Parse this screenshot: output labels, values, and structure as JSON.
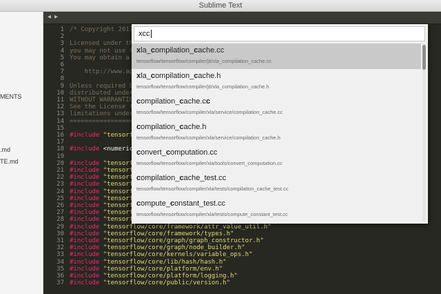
{
  "window": {
    "title": "Sublime Text"
  },
  "sidebar": {
    "items": [
      {
        "label": "MENTS"
      },
      {
        "label": ".md"
      },
      {
        "label": "TE.md"
      }
    ]
  },
  "tabbar": {
    "back": "◂",
    "forward": "▸"
  },
  "palette": {
    "query": "xcc",
    "results": [
      {
        "pre1": "",
        "m1": "x",
        "mid1": "la_",
        "m2": "c",
        "mid2": "ompilation_",
        "m3": "c",
        "post": "ache.cc",
        "path": "tensorflow/tensorflow/compiler/jit/xla_compilation_cache.cc"
      },
      {
        "pre1": "",
        "m1": "x",
        "mid1": "la_",
        "m2": "c",
        "mid2": "ompilation_",
        "m3": "c",
        "post": "ache.h",
        "path": "tensorflow/tensorflow/compiler/jit/xla_compilation_cache.h"
      },
      {
        "pre1": "",
        "m1": "c",
        "mid1": "ompilation_",
        "m2": "c",
        "mid2": "ache.c",
        "m3": "c",
        "post": "",
        "path": "tensorflow/tensorflow/compiler/xla/service/compilation_cache.cc"
      },
      {
        "pre1": "",
        "m1": "c",
        "mid1": "ompilation_",
        "m2": "c",
        "mid2": "ache.h",
        "m3": "",
        "post": "",
        "path": "tensorflow/tensorflow/compiler/xla/service/compilation_cache.h"
      },
      {
        "pre1": "",
        "m1": "c",
        "mid1": "onvert_",
        "m2": "c",
        "mid2": "omputation.cc",
        "m3": "",
        "post": "",
        "path": "tensorflow/tensorflow/compiler/xla/tools/convert_computation.cc"
      },
      {
        "pre1": "",
        "m1": "c",
        "mid1": "ompilation_",
        "m2": "c",
        "mid2": "ache_test.cc",
        "m3": "",
        "post": "",
        "path": "tensorflow/tensorflow/compiler/xla/tests/compilation_cache_test.cc"
      },
      {
        "pre1": "",
        "m1": "c",
        "mid1": "ompute_",
        "m2": "c",
        "mid2": "onstant_test.cc",
        "m3": "",
        "post": "",
        "path": "tensorflow/tensorflow/compiler/xla/tests/compute_constant_test.cc"
      }
    ]
  },
  "editor": {
    "lines": [
      {
        "n": "1",
        "kind": "cm",
        "a": "/* Copyright 2017",
        "b": ""
      },
      {
        "n": "2",
        "kind": "cm",
        "a": "",
        "b": ""
      },
      {
        "n": "3",
        "kind": "cm",
        "a": "Licensed under the",
        "b": ""
      },
      {
        "n": "4",
        "kind": "cm",
        "a": "you may not use th",
        "b": ""
      },
      {
        "n": "5",
        "kind": "cm",
        "a": "You may obtain a c",
        "b": ""
      },
      {
        "n": "6",
        "kind": "cm",
        "a": "",
        "b": ""
      },
      {
        "n": "7",
        "kind": "cm",
        "a": "    http://www.apa",
        "b": ""
      },
      {
        "n": "8",
        "kind": "cm",
        "a": "",
        "b": ""
      },
      {
        "n": "9",
        "kind": "cm",
        "a": "Unless required by",
        "b": ""
      },
      {
        "n": "10",
        "kind": "cm",
        "a": "distributed under",
        "b": ""
      },
      {
        "n": "11",
        "kind": "cm",
        "a": "WITHOUT WARRANTIES",
        "b": ""
      },
      {
        "n": "12",
        "kind": "cm",
        "a": "See the License fo",
        "b": ""
      },
      {
        "n": "13",
        "kind": "cm",
        "a": "limitations under",
        "b": ""
      },
      {
        "n": "14",
        "kind": "cm",
        "a": "==================",
        "b": ""
      },
      {
        "n": "15",
        "kind": "blank",
        "a": "",
        "b": ""
      },
      {
        "n": "16",
        "kind": "inc",
        "a": "#include",
        "b": " \"tensorfl"
      },
      {
        "n": "17",
        "kind": "blank",
        "a": "",
        "b": ""
      },
      {
        "n": "18",
        "kind": "inc2",
        "a": "#include",
        "b": " <numeric"
      },
      {
        "n": "19",
        "kind": "blank",
        "a": "",
        "b": ""
      },
      {
        "n": "20",
        "kind": "inc",
        "a": "#include",
        "b": " \"tensorfl"
      },
      {
        "n": "21",
        "kind": "inc",
        "a": "#include",
        "b": " \"tensorfl"
      },
      {
        "n": "22",
        "kind": "inc",
        "a": "#include",
        "b": " \"tensorfl"
      },
      {
        "n": "23",
        "kind": "inc",
        "a": "#include",
        "b": " \"tensorfl"
      },
      {
        "n": "24",
        "kind": "inc",
        "a": "#include",
        "b": " \"tensorfl"
      },
      {
        "n": "25",
        "kind": "inc",
        "a": "#include",
        "b": " \"tensorfl"
      },
      {
        "n": "26",
        "kind": "inc",
        "a": "#include",
        "b": " \"tensorfl"
      },
      {
        "n": "27",
        "kind": "inc",
        "a": "#include",
        "b": " \"tensorfl"
      },
      {
        "n": "28",
        "kind": "inc",
        "a": "#include",
        "b": " \"tensorflow/core/common_runtime/graph_optimizer.h\""
      },
      {
        "n": "29",
        "kind": "inc",
        "a": "#include",
        "b": " \"tensorflow/core/framework/attr_value_util.h\""
      },
      {
        "n": "30",
        "kind": "inc",
        "a": "#include",
        "b": " \"tensorflow/core/framework/types.h\""
      },
      {
        "n": "31",
        "kind": "inc",
        "a": "#include",
        "b": " \"tensorflow/core/graph/graph_constructor.h\""
      },
      {
        "n": "32",
        "kind": "inc",
        "a": "#include",
        "b": " \"tensorflow/core/graph/node_builder.h\""
      },
      {
        "n": "33",
        "kind": "inc",
        "a": "#include",
        "b": " \"tensorflow/core/kernels/variable_ops.h\""
      },
      {
        "n": "34",
        "kind": "inc",
        "a": "#include",
        "b": " \"tensorflow/core/lib/hash/hash.h\""
      },
      {
        "n": "35",
        "kind": "inc",
        "a": "#include",
        "b": " \"tensorflow/core/platform/env.h\""
      },
      {
        "n": "36",
        "kind": "inc",
        "a": "#include",
        "b": " \"tensorflow/core/platform/logging.h\""
      },
      {
        "n": "37",
        "kind": "inc",
        "a": "#include",
        "b": " \"tensorflow/core/public/version.h\""
      }
    ]
  }
}
